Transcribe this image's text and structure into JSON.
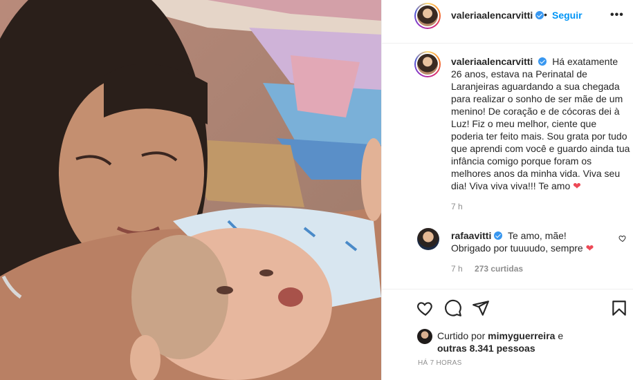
{
  "post": {
    "username": "valeriaalencarvitti",
    "separator": "•",
    "follow_label": "Seguir",
    "more_label": "•••"
  },
  "caption": {
    "username": "valeriaalencarvitti",
    "text": "Há exatamente 26 anos, estava na Perinatal de Laranjeiras aguardando a sua chegada para realizar o sonho de ser mãe de um menino! De coração e de cócoras dei à Luz! Fiz o meu melhor, ciente que poderia ter feito mais. Sou grata por tudo que aprendi com você e guardo ainda tua infância comigo porque foram os melhores anos da minha vida. Viva seu dia! Viva viva viva!!! Te amo",
    "emoji": "❤",
    "time": "7 h"
  },
  "comment": {
    "username": "rafaavitti",
    "text": "Te amo, mãe! Obrigado por tuuuudo, sempre",
    "emoji": "❤",
    "time": "7 h",
    "likes": "273 curtidas"
  },
  "actions": {
    "like_icon": "heart-icon",
    "comment_icon": "comment-icon",
    "share_icon": "paper-plane-icon",
    "save_icon": "bookmark-icon"
  },
  "likes": {
    "prefix": "Curtido por",
    "user": "mimyguerreira",
    "conj": "e",
    "others": "outras 8.341 pessoas"
  },
  "timeago": "HÁ 7 HORAS",
  "colors": {
    "link_blue": "#0095f6",
    "verified_blue": "#3897f0",
    "heart_red": "#ed4956",
    "muted": "#8e8e8e"
  }
}
